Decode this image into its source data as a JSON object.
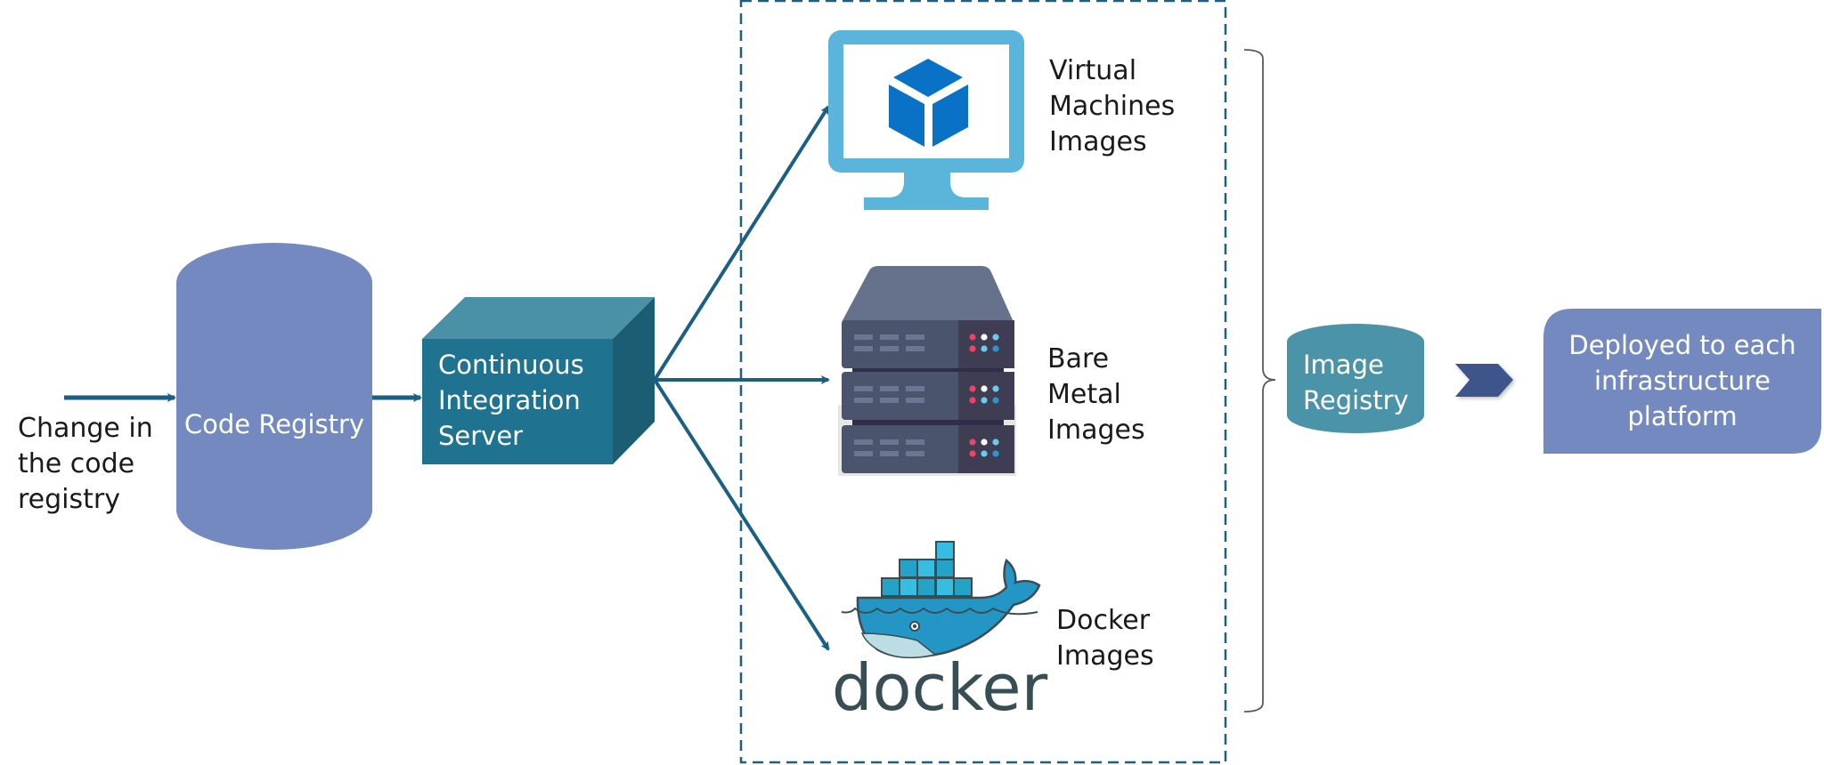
{
  "diagram": {
    "trigger_label": [
      "Change in",
      "the code",
      "registry"
    ],
    "code_registry": {
      "label": "Code Registry",
      "color": "#7489c0"
    },
    "ci_server": {
      "label": [
        "Continuous",
        "Integration",
        "Server"
      ],
      "front_color": "#1f7390",
      "top_color": "#4a91a8",
      "side_color": "#1b5e73"
    },
    "image_types": [
      {
        "label": [
          "Virtual",
          "Machines",
          "Images"
        ],
        "icon": "virtual-machine-monitor-icon"
      },
      {
        "label": [
          "Bare",
          "Metal",
          "Images"
        ],
        "icon": "server-rack-icon"
      },
      {
        "label": [
          "Docker",
          "Images"
        ],
        "icon": "docker-logo-icon",
        "logo_text": "docker"
      }
    ],
    "image_registry": {
      "label": [
        "Image",
        "Registry"
      ],
      "color": "#4a93a8"
    },
    "deploy": {
      "label": [
        "Deployed to each",
        "infrastructure",
        "platform"
      ],
      "color": "#7489c0"
    },
    "colors": {
      "arrow": "#1a5f84",
      "dashed_box": "#1a5f84",
      "brace": "#595959",
      "chevron": "#3c548a",
      "monitor": "#5bb5db",
      "vm_cube": "#0a72c6",
      "server_body": "#4a546d",
      "server_panel": "#3e3d54",
      "server_top": "#66718c",
      "docker_blue": "#2496c6",
      "docker_dark": "#394d54"
    }
  }
}
